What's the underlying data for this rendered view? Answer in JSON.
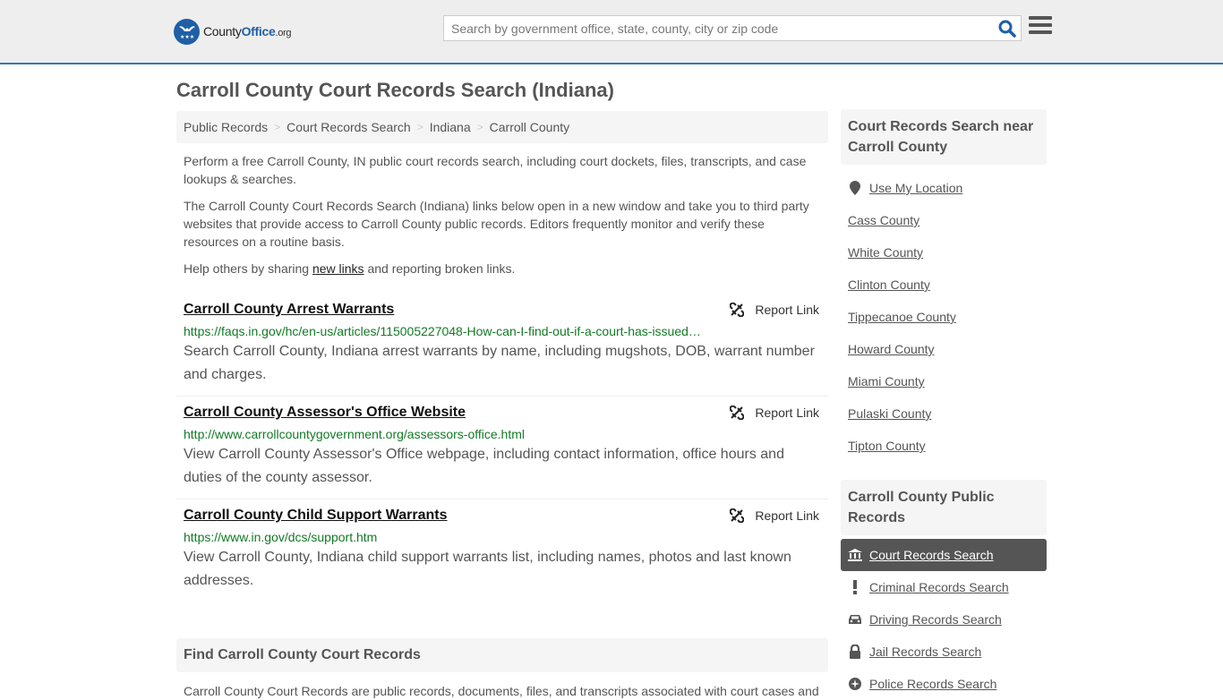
{
  "header": {
    "logo": {
      "county": "County",
      "office": "Office",
      "tld": ".org"
    },
    "search_placeholder": "Search by government office, state, county, city or zip code",
    "search_icon": "search-icon",
    "menu_icon": "hamburger-menu-icon"
  },
  "page_title": "Carroll County Court Records Search (Indiana)",
  "breadcrumb": [
    {
      "label": "Public Records"
    },
    {
      "label": "Court Records Search"
    },
    {
      "label": "Indiana"
    },
    {
      "label": "Carroll County"
    }
  ],
  "intro": {
    "p1": "Perform a free Carroll County, IN public court records search, including court dockets, files, transcripts, and case lookups & searches.",
    "p2": "The Carroll County Court Records Search (Indiana) links below open in a new window and take you to third party websites that provide access to Carroll County public records. Editors frequently monitor and verify these resources on a routine basis.",
    "p3_before": "Help others by sharing ",
    "p3_link": "new links",
    "p3_after": " and reporting broken links."
  },
  "links": [
    {
      "title": "Carroll County Arrest Warrants",
      "url": "https://faqs.in.gov/hc/en-us/articles/115005227048-How-can-I-find-out-if-a-court-has-issued…",
      "description": "Search Carroll County, Indiana arrest warrants by name, including mugshots, DOB, warrant number and charges.",
      "report_label": "Report Link"
    },
    {
      "title": "Carroll County Assessor's Office Website",
      "url": "http://www.carrollcountygovernment.org/assessors-office.html",
      "description": "View Carroll County Assessor's Office webpage, including contact information, office hours and duties of the county assessor.",
      "report_label": "Report Link"
    },
    {
      "title": "Carroll County Child Support Warrants",
      "url": "https://www.in.gov/dcs/support.htm",
      "description": "View Carroll County, Indiana child support warrants list, including names, photos and last known addresses.",
      "report_label": "Report Link"
    }
  ],
  "find_section": {
    "heading": "Find Carroll County Court Records",
    "text": "Carroll County Court Records are public records, documents, files, and transcripts associated with court cases and"
  },
  "sidebar": {
    "nearby": {
      "heading": "Court Records Search near Carroll County",
      "use_location": "Use My Location",
      "counties": [
        "Cass County",
        "White County",
        "Clinton County",
        "Tippecanoe County",
        "Howard County",
        "Miami County",
        "Pulaski County",
        "Tipton County"
      ]
    },
    "public_records": {
      "heading": "Carroll County Public Records",
      "items": [
        {
          "label": "Court Records Search",
          "icon": "courthouse-icon",
          "active": true
        },
        {
          "label": "Criminal Records Search",
          "icon": "exclamation-icon",
          "active": false
        },
        {
          "label": "Driving Records Search",
          "icon": "car-icon",
          "active": false
        },
        {
          "label": "Jail Records Search",
          "icon": "lock-icon",
          "active": false
        },
        {
          "label": "Police Records Search",
          "icon": "police-badge-icon",
          "active": false
        }
      ]
    }
  },
  "colors": {
    "brand_blue": "#1f5fa6",
    "header_border": "#337ab7",
    "url_green": "#137a25",
    "active_bg": "#555555"
  }
}
